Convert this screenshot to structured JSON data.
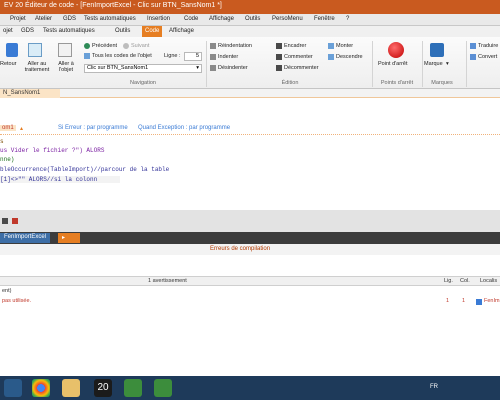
{
  "window": {
    "title": "EV 20  Éditeur de code - [FenImportExcel - Clic sur BTN_SansNom1 *]"
  },
  "menu": [
    "Projet",
    "Atelier",
    "GDS",
    "Tests automatiques",
    "Insertion",
    "Code",
    "Affichage",
    "Outils",
    "PersoMenu",
    "Fenêtre",
    "?"
  ],
  "tabs": [
    "ojet",
    "GDS",
    "Tests automatiques",
    "Outils",
    "Code",
    "Affichage"
  ],
  "ribbon": {
    "retour": "Retour",
    "aller_traitement": "Aller au traitement",
    "aller_objet": "Aller à l'objet",
    "precedent": "Précédent",
    "suivant": "Suivant",
    "tous_codes": "Tous les codes de l'objet",
    "ligne_label": "Ligne :",
    "ligne_value": "5",
    "combo_value": "Clic sur BTN_SansNom1",
    "group_navigation": "Navigation",
    "reindentation": "Réindentation",
    "indenter": "Indenter",
    "desindenter": "Désindenter",
    "encadrer": "Encadrer",
    "commenter": "Commenter",
    "decommenter": "Décommenter",
    "monter": "Monter",
    "descendre": "Descendre",
    "group_edition": "Édition",
    "point_arret": "Point d'arrêt",
    "group_points": "Points d'arrêt",
    "marque": "Marque",
    "group_marques": "Marques",
    "traduire": "Traduire",
    "convertir": "Convert"
  },
  "doc_tab": "N_SansNom1",
  "editor": {
    "event_name": "om1",
    "event_sinon": "Si Erreur : par programme",
    "event_exception": "Quand Exception : par programme",
    "lines": [
      {
        "text": "s",
        "color": "#7a4a00"
      },
      {
        "text": "us Vider le fichier ?\") ALORS",
        "color": "#7a1fa2"
      },
      {
        "text": "nne)",
        "color": "#1a6f1a"
      },
      {
        "text": "bleOccurrence(TableImport)//parcour de la table",
        "color": "#333399"
      },
      {
        "text": "[1]<>\"\" ALORS//si la colonn",
        "color": "#333399"
      }
    ]
  },
  "window_tabs": [
    "FenImportExcel"
  ],
  "panel": {
    "title": "Erreurs de compilation",
    "col_main": "1 avertissement",
    "col_lig": "Lig.",
    "col_col": "Col.",
    "col_loc": "Localis",
    "row1": "ent)",
    "row2": "pas utilisée.",
    "row2_lig": "1",
    "row2_col": "1",
    "row2_loc": "FenIm"
  },
  "taskbar": {
    "lang": "FR",
    "app20": "20"
  },
  "colors": {
    "accent": "#e67e22",
    "title": "#c95a1f"
  }
}
